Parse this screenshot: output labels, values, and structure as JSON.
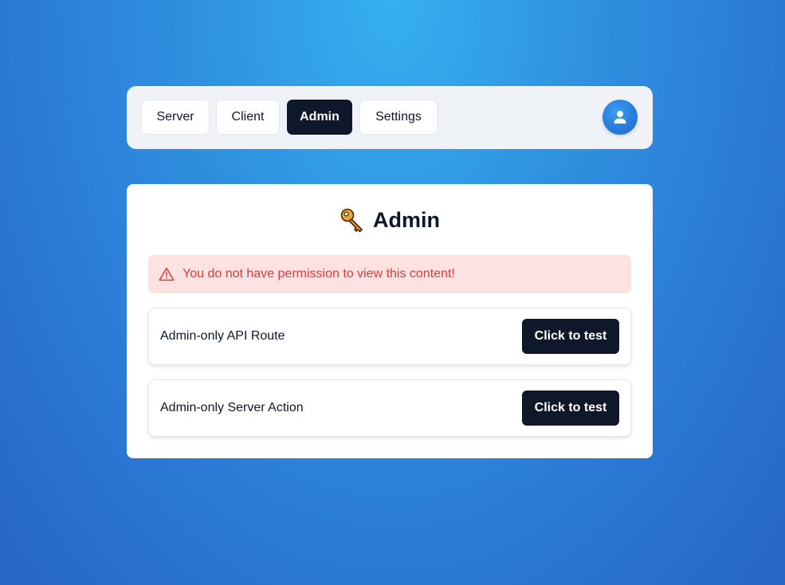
{
  "nav": {
    "items": [
      {
        "label": "Server",
        "active": false
      },
      {
        "label": "Client",
        "active": false
      },
      {
        "label": "Admin",
        "active": true
      },
      {
        "label": "Settings",
        "active": false
      }
    ],
    "avatar_icon": "user-icon"
  },
  "card": {
    "title_icon": "key-icon",
    "title": "Admin",
    "alert": {
      "icon": "warning-icon",
      "text": "You do not have permission to view this content!",
      "color": "#dc3b3b",
      "background": "#fee2e2"
    },
    "rows": [
      {
        "label": "Admin-only API Route",
        "button": "Click to test"
      },
      {
        "label": "Admin-only Server Action",
        "button": "Click to test"
      }
    ]
  },
  "colors": {
    "active_button": "#0f172a",
    "navbar_background": "#eff3f8",
    "accent_blue": "#2a7fe0"
  }
}
